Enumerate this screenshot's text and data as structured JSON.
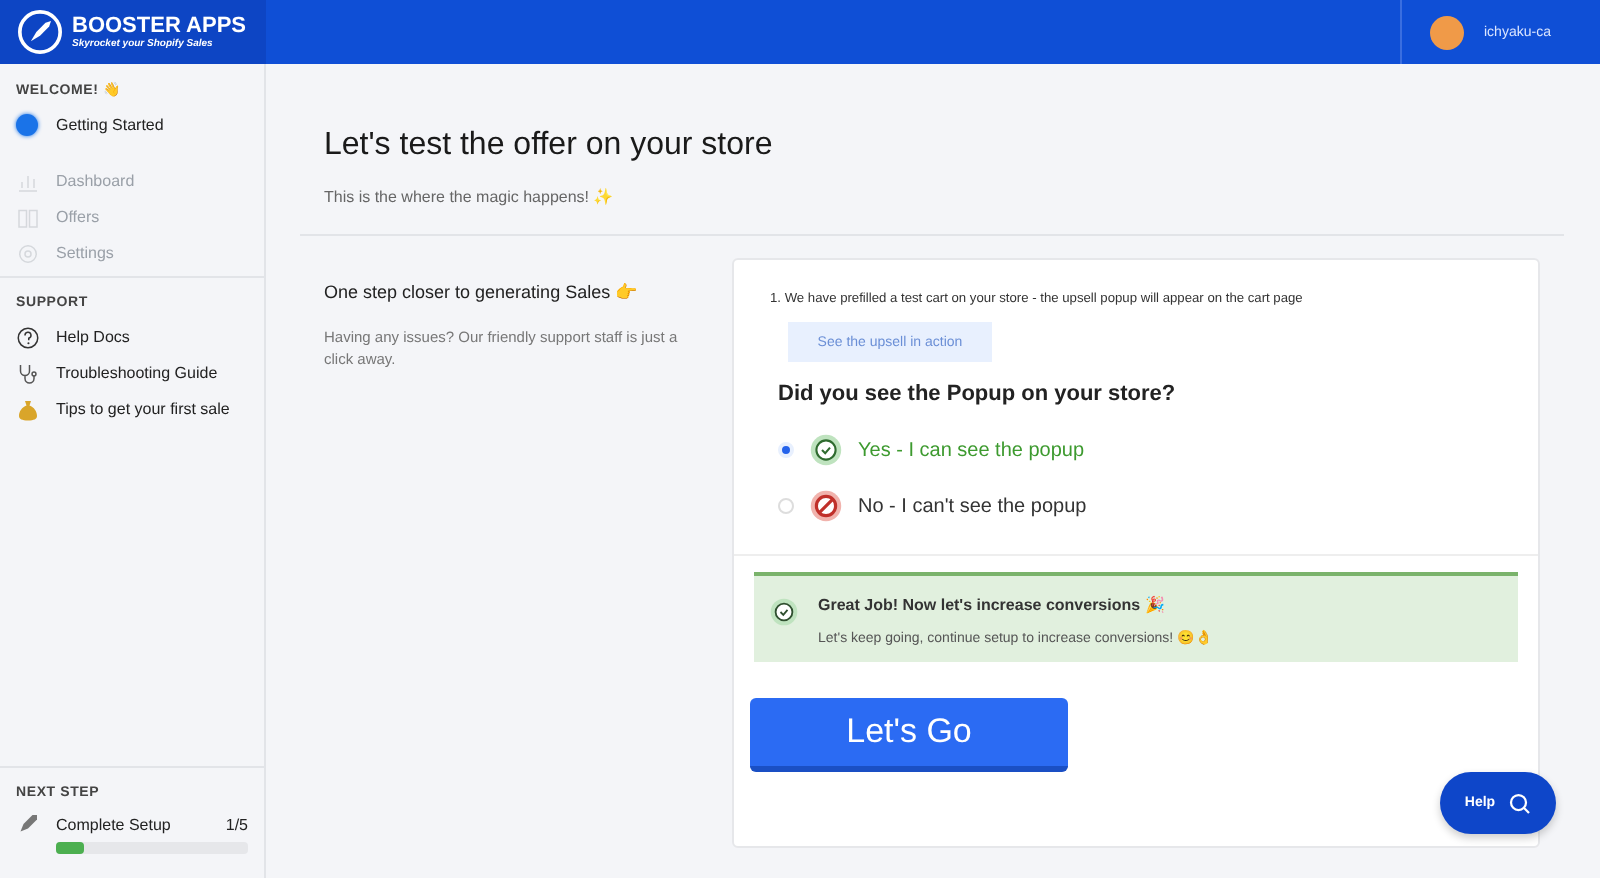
{
  "header": {
    "logo_title": "BOOSTER APPS",
    "logo_tagline": "Skyrocket your Shopify Sales",
    "user": "ichyaku-ca"
  },
  "sidebar": {
    "welcome_heading": "WELCOME! 👋",
    "nav_items": [
      {
        "label": "Getting Started",
        "kind": "dot",
        "disabled": false
      },
      {
        "label": "Dashboard",
        "kind": "chart",
        "disabled": true
      },
      {
        "label": "Offers",
        "kind": "book",
        "disabled": true
      },
      {
        "label": "Settings",
        "kind": "gear",
        "disabled": true
      }
    ],
    "support_heading": "SUPPORT",
    "support_items": [
      {
        "label": "Help Docs",
        "kind": "question"
      },
      {
        "label": "Troubleshooting Guide",
        "kind": "stethoscope"
      },
      {
        "label": "Tips to get your first sale",
        "kind": "moneybag"
      }
    ],
    "next_step": {
      "heading": "NEXT STEP",
      "label": "Complete Setup",
      "count": "1/5",
      "level": 0.15
    }
  },
  "main": {
    "title": "Let's test the offer on your store",
    "subtitle": "This is the where the magic happens! ✨",
    "side_heading": "One step closer to generating Sales 👉",
    "side_text": "Having any issues? Our friendly support staff is just a click away.",
    "step_text": "1. We have prefilled a test cart on your store - the upsell popup will appear on the cart page",
    "upsell_button": {
      "label": "See the upsell in action",
      "disabled": true
    },
    "question": "Did you see the Popup on your store?",
    "options": [
      {
        "label": "Yes - I can see the popup",
        "kind": "yes",
        "selected": true
      },
      {
        "label": "No - I can't see the popup",
        "kind": "no",
        "selected": false
      }
    ],
    "success": {
      "title": "Great Job! Now let's increase conversions 🎉",
      "text": "Let's keep going, continue setup to increase conversions! 😊👌"
    },
    "go_button": "Let's Go"
  },
  "help_button": "Help"
}
